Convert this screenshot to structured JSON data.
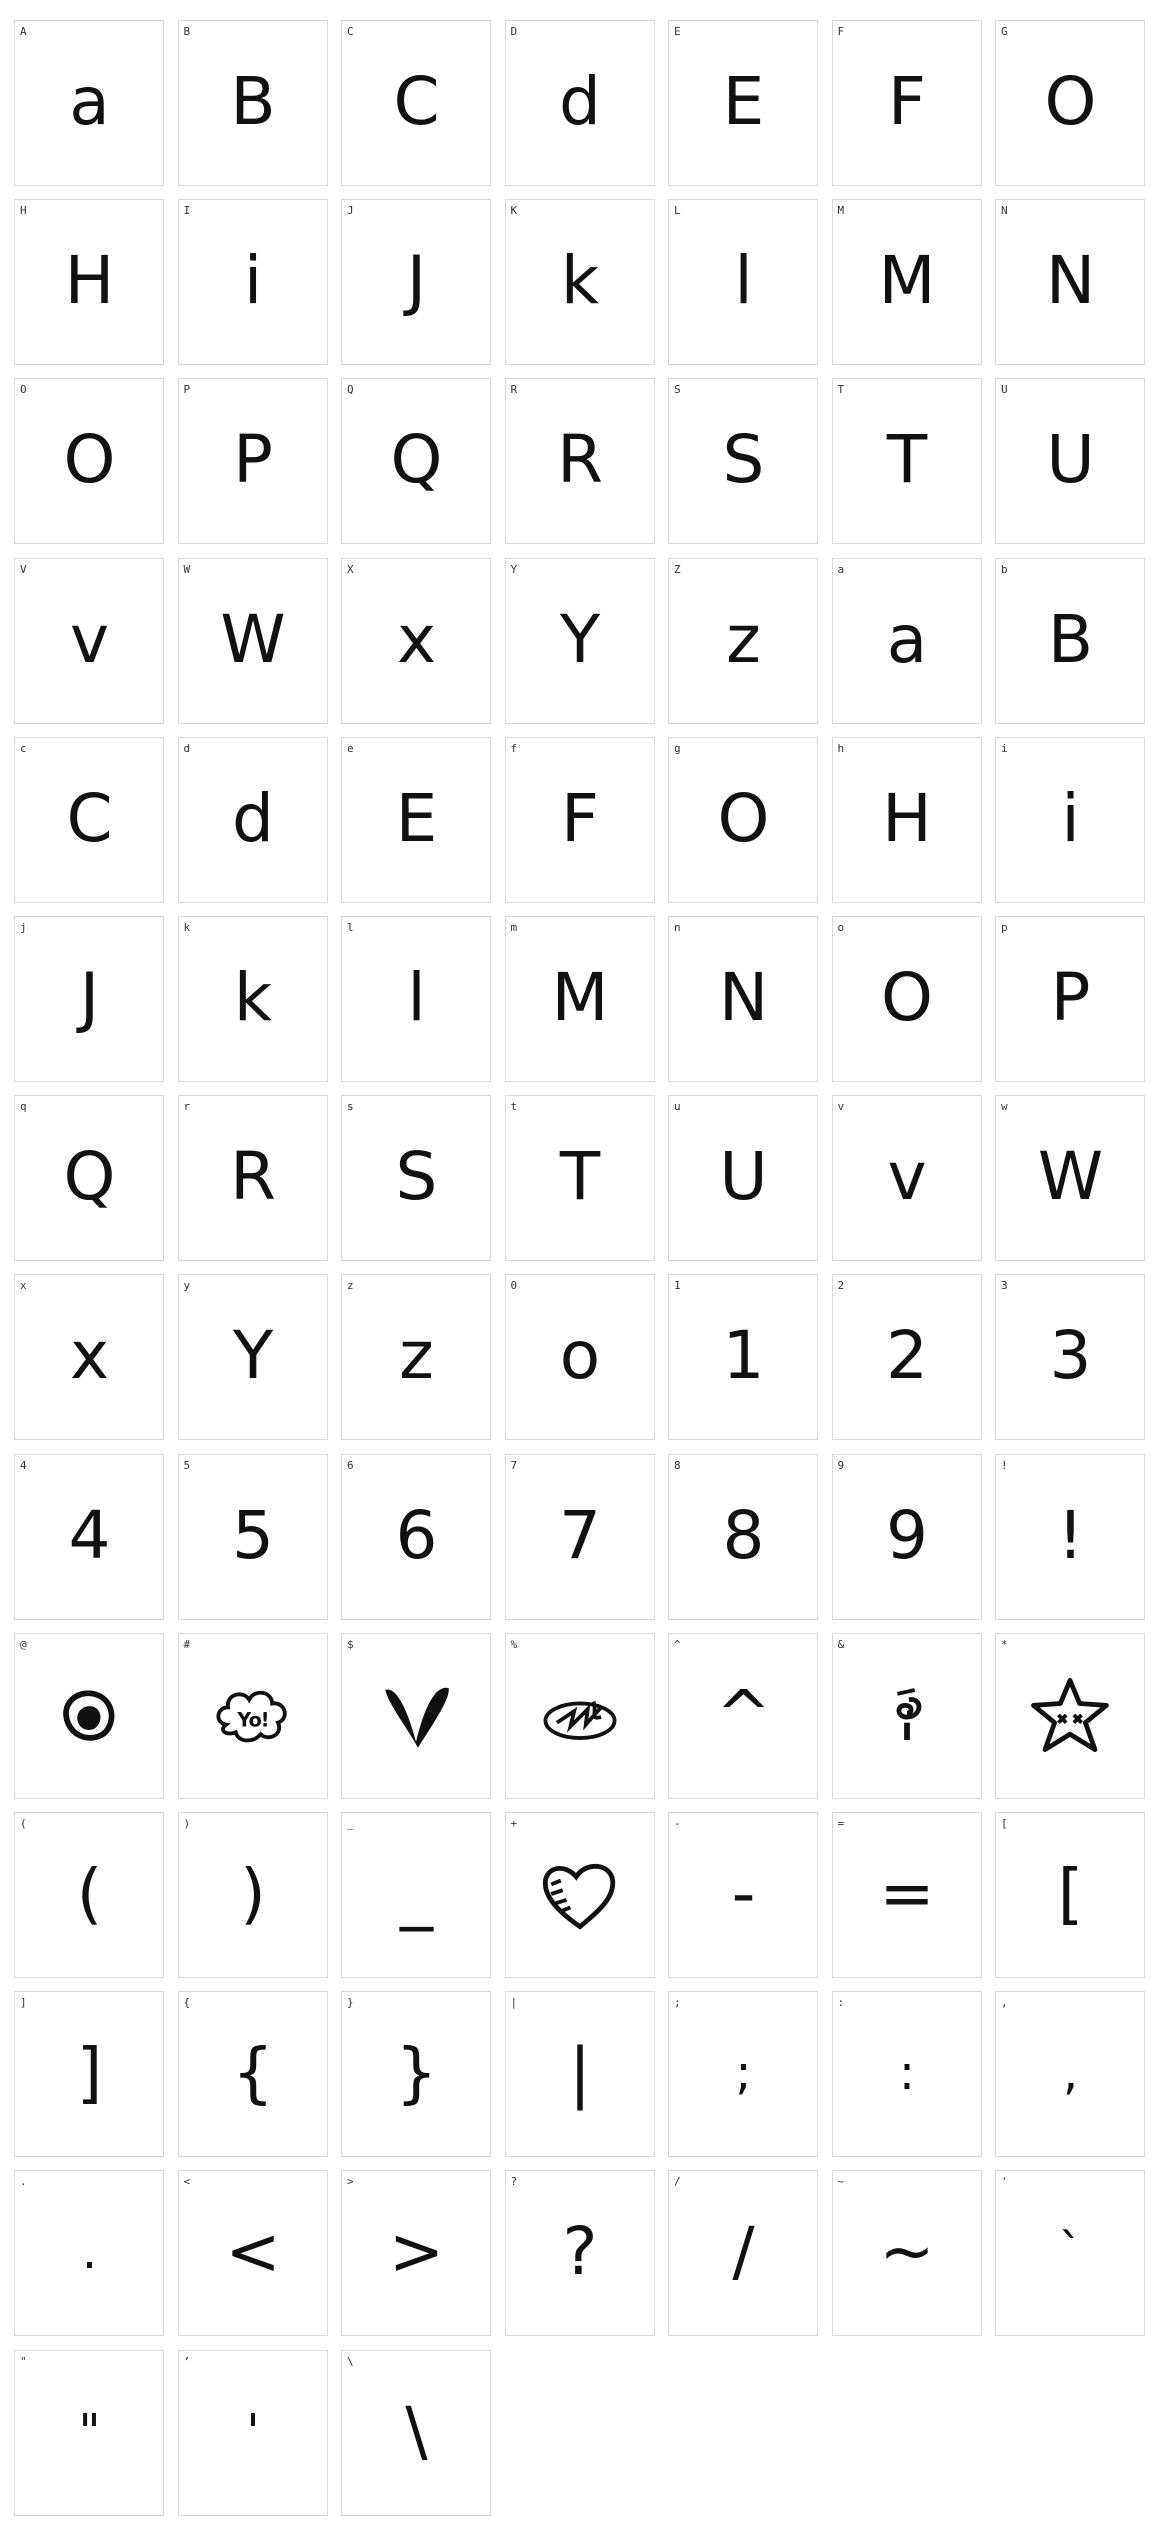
{
  "glyph_grid": {
    "cells": [
      {
        "label": "A",
        "glyph": "a"
      },
      {
        "label": "B",
        "glyph": "B"
      },
      {
        "label": "C",
        "glyph": "C"
      },
      {
        "label": "D",
        "glyph": "d"
      },
      {
        "label": "E",
        "glyph": "E"
      },
      {
        "label": "F",
        "glyph": "F"
      },
      {
        "label": "G",
        "glyph": "O"
      },
      {
        "label": "H",
        "glyph": "H"
      },
      {
        "label": "I",
        "glyph": "i"
      },
      {
        "label": "J",
        "glyph": "J"
      },
      {
        "label": "K",
        "glyph": "k"
      },
      {
        "label": "L",
        "glyph": "l"
      },
      {
        "label": "M",
        "glyph": "M"
      },
      {
        "label": "N",
        "glyph": "N"
      },
      {
        "label": "O",
        "glyph": "O"
      },
      {
        "label": "P",
        "glyph": "P"
      },
      {
        "label": "Q",
        "glyph": "Q"
      },
      {
        "label": "R",
        "glyph": "R"
      },
      {
        "label": "S",
        "glyph": "S"
      },
      {
        "label": "T",
        "glyph": "T"
      },
      {
        "label": "U",
        "glyph": "U"
      },
      {
        "label": "V",
        "glyph": "v"
      },
      {
        "label": "W",
        "glyph": "W"
      },
      {
        "label": "X",
        "glyph": "x"
      },
      {
        "label": "Y",
        "glyph": "Y"
      },
      {
        "label": "Z",
        "glyph": "z"
      },
      {
        "label": "a",
        "glyph": "a"
      },
      {
        "label": "b",
        "glyph": "B"
      },
      {
        "label": "c",
        "glyph": "C"
      },
      {
        "label": "d",
        "glyph": "d"
      },
      {
        "label": "e",
        "glyph": "E"
      },
      {
        "label": "f",
        "glyph": "F"
      },
      {
        "label": "g",
        "glyph": "O"
      },
      {
        "label": "h",
        "glyph": "H"
      },
      {
        "label": "i",
        "glyph": "i"
      },
      {
        "label": "j",
        "glyph": "J"
      },
      {
        "label": "k",
        "glyph": "k"
      },
      {
        "label": "l",
        "glyph": "l"
      },
      {
        "label": "m",
        "glyph": "M"
      },
      {
        "label": "n",
        "glyph": "N"
      },
      {
        "label": "o",
        "glyph": "O"
      },
      {
        "label": "p",
        "glyph": "P"
      },
      {
        "label": "q",
        "glyph": "Q"
      },
      {
        "label": "r",
        "glyph": "R"
      },
      {
        "label": "s",
        "glyph": "S"
      },
      {
        "label": "t",
        "glyph": "T"
      },
      {
        "label": "u",
        "glyph": "U"
      },
      {
        "label": "v",
        "glyph": "v"
      },
      {
        "label": "w",
        "glyph": "W"
      },
      {
        "label": "x",
        "glyph": "x"
      },
      {
        "label": "y",
        "glyph": "Y"
      },
      {
        "label": "z",
        "glyph": "z"
      },
      {
        "label": "0",
        "glyph": "o"
      },
      {
        "label": "1",
        "glyph": "1"
      },
      {
        "label": "2",
        "glyph": "2"
      },
      {
        "label": "3",
        "glyph": "3"
      },
      {
        "label": "4",
        "glyph": "4"
      },
      {
        "label": "5",
        "glyph": "5"
      },
      {
        "label": "6",
        "glyph": "6"
      },
      {
        "label": "7",
        "glyph": "7"
      },
      {
        "label": "8",
        "glyph": "8"
      },
      {
        "label": "9",
        "glyph": "9"
      },
      {
        "label": "!",
        "glyph": "!"
      },
      {
        "label": "@",
        "glyph": "",
        "icon": "blob-icon"
      },
      {
        "label": "#",
        "glyph": "",
        "icon": "cloud-yo-icon"
      },
      {
        "label": "$",
        "glyph": "",
        "icon": "heart-v-icon"
      },
      {
        "label": "%",
        "glyph": "",
        "icon": "scribble-icon"
      },
      {
        "label": "^",
        "glyph": "^"
      },
      {
        "label": "&",
        "glyph": "",
        "icon": "swirl-i-icon"
      },
      {
        "label": "*",
        "glyph": "",
        "icon": "star-face-icon"
      },
      {
        "label": "(",
        "glyph": "("
      },
      {
        "label": ")",
        "glyph": ")"
      },
      {
        "label": "_",
        "glyph": "_"
      },
      {
        "label": "+",
        "glyph": "",
        "icon": "heart-icon"
      },
      {
        "label": "-",
        "glyph": "-"
      },
      {
        "label": "=",
        "glyph": "="
      },
      {
        "label": "[",
        "glyph": "["
      },
      {
        "label": "]",
        "glyph": "]"
      },
      {
        "label": "{",
        "glyph": "{"
      },
      {
        "label": "}",
        "glyph": "}"
      },
      {
        "label": "|",
        "glyph": "|"
      },
      {
        "label": ";",
        "glyph": ";"
      },
      {
        "label": ":",
        "glyph": ":"
      },
      {
        "label": ",",
        "glyph": ","
      },
      {
        "label": ".",
        "glyph": "."
      },
      {
        "label": "<",
        "glyph": "<"
      },
      {
        "label": ">",
        "glyph": ">"
      },
      {
        "label": "?",
        "glyph": "?"
      },
      {
        "label": "/",
        "glyph": "/"
      },
      {
        "label": "~",
        "glyph": "~"
      },
      {
        "label": "'",
        "glyph": "`"
      },
      {
        "label": "\"",
        "glyph": "\""
      },
      {
        "label": "’",
        "glyph": "'"
      },
      {
        "label": "\\",
        "glyph": "\\"
      }
    ]
  }
}
